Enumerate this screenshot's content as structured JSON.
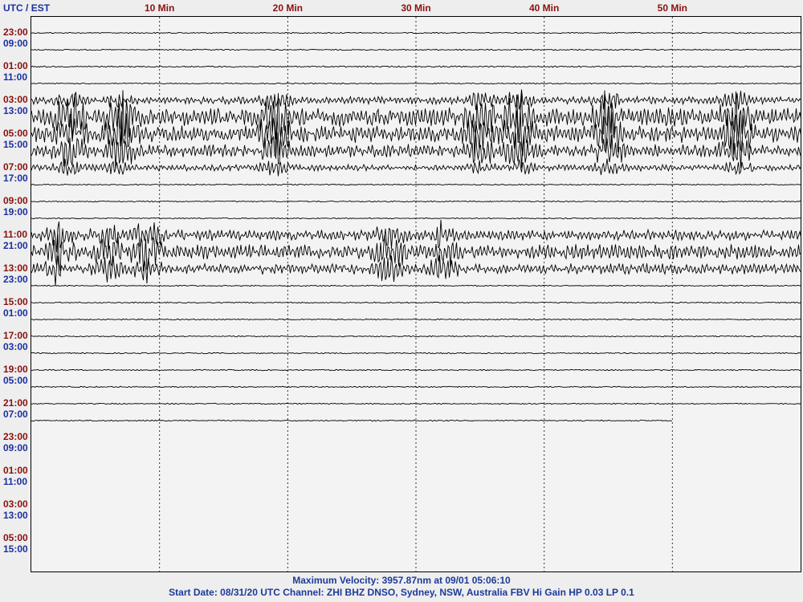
{
  "header": {
    "utc_label": "UTC",
    "separator": "/",
    "est_label": "EST"
  },
  "footer": {
    "max_velocity": "Maximum Velocity: 3957.87nm at 09/01 05:06:10",
    "start_info": "Start Date: 08/31/20 UTC Channel: ZHI  BHZ  DNSO, Sydney, NSW, Australia  FBV Hi Gain HP 0.03  LP 0.1"
  },
  "chart_data": {
    "type": "line",
    "title": "",
    "x_unit": "Min",
    "x_range": [
      0,
      60
    ],
    "x_ticks": [
      {
        "value": 10,
        "label": "10 Min"
      },
      {
        "value": 20,
        "label": "20 Min"
      },
      {
        "value": 30,
        "label": "30 Min"
      },
      {
        "value": 40,
        "label": "40 Min"
      },
      {
        "value": 50,
        "label": "50 Min"
      }
    ],
    "grid": "dashed vertical at 10-minute intervals",
    "row_count": 24,
    "last_row_end_min": 50,
    "time_labels": [
      {
        "utc": "23:00",
        "est": "09:00"
      },
      {
        "utc": "01:00",
        "est": "11:00"
      },
      {
        "utc": "03:00",
        "est": "13:00"
      },
      {
        "utc": "05:00",
        "est": "15:00"
      },
      {
        "utc": "07:00",
        "est": "17:00"
      },
      {
        "utc": "09:00",
        "est": "19:00"
      },
      {
        "utc": "11:00",
        "est": "21:00"
      },
      {
        "utc": "13:00",
        "est": "23:00"
      },
      {
        "utc": "15:00",
        "est": "01:00"
      },
      {
        "utc": "17:00",
        "est": "03:00"
      },
      {
        "utc": "19:00",
        "est": "05:00"
      },
      {
        "utc": "21:00",
        "est": "07:00"
      },
      {
        "utc": "23:00",
        "est": "09:00"
      },
      {
        "utc": "01:00",
        "est": "11:00"
      },
      {
        "utc": "03:00",
        "est": "13:00"
      },
      {
        "utc": "05:00",
        "est": "15:00"
      }
    ],
    "trace_amplitude_by_row": [
      1,
      1,
      1.2,
      1,
      3.5,
      9,
      8,
      6,
      3,
      1,
      1,
      1,
      1,
      1,
      1,
      1,
      1,
      1,
      1,
      1,
      1,
      1,
      1,
      1
    ],
    "events": [
      {
        "row_start": 4,
        "row_end": 8,
        "strong_minutes": [
          3,
          7,
          19,
          35,
          38,
          45,
          55
        ]
      },
      {
        "row_start": 12,
        "row_end": 14,
        "strong_minutes": [
          2,
          6,
          9,
          28,
          32
        ]
      }
    ],
    "series": [
      {
        "name": "ZHI BHZ",
        "color": "#000000"
      }
    ],
    "colors": {
      "utc": "#8a1010",
      "est": "#1c2fa0",
      "footer": "#1c3a9a",
      "trace": "#000000",
      "background": "#f3f3f3"
    }
  }
}
